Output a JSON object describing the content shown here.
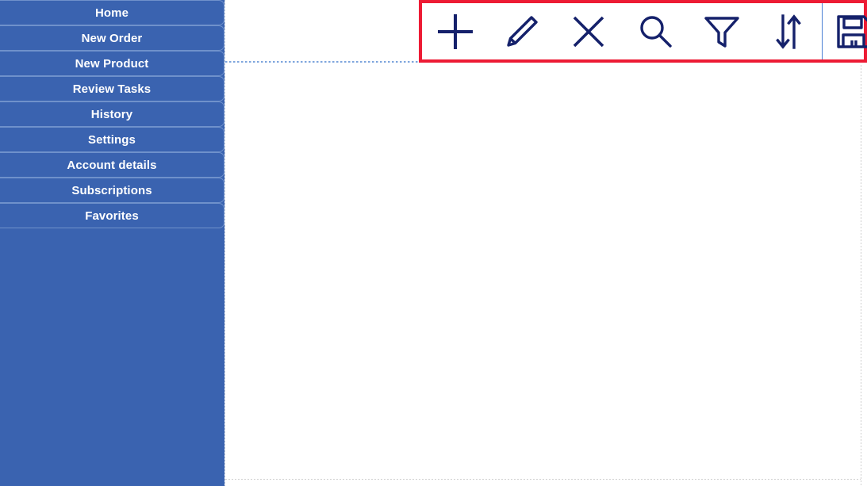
{
  "theme": {
    "sidebar_bg": "#3a63b0",
    "sidebar_item_border": "#6f91cb",
    "sidebar_text": "#ffffff",
    "icon_navy": "#15216b",
    "highlight_red": "#ed1b34",
    "divider_blue": "#4a7fd4",
    "content_bg": "#ffffff",
    "dotted_guide": "#7ea5dd"
  },
  "sidebar": {
    "items": [
      {
        "id": "home",
        "label": "Home"
      },
      {
        "id": "new-order",
        "label": "New Order"
      },
      {
        "id": "new-product",
        "label": "New Product"
      },
      {
        "id": "review-tasks",
        "label": "Review Tasks"
      },
      {
        "id": "history",
        "label": "History"
      },
      {
        "id": "settings",
        "label": "Settings"
      },
      {
        "id": "account-details",
        "label": "Account details"
      },
      {
        "id": "subscriptions",
        "label": "Subscriptions"
      },
      {
        "id": "favorites",
        "label": "Favorites"
      }
    ]
  },
  "toolbar": {
    "actions": [
      {
        "id": "add",
        "icon": "plus-icon",
        "label": "Add"
      },
      {
        "id": "edit",
        "icon": "pencil-icon",
        "label": "Edit"
      },
      {
        "id": "delete",
        "icon": "close-x-icon",
        "label": "Delete"
      },
      {
        "id": "search",
        "icon": "search-icon",
        "label": "Search"
      },
      {
        "id": "filter",
        "icon": "filter-funnel-icon",
        "label": "Filter"
      },
      {
        "id": "sort",
        "icon": "sort-arrows-icon",
        "label": "Sort"
      }
    ],
    "save": {
      "id": "save",
      "icon": "save-floppy-icon",
      "label": "Save"
    }
  },
  "main": {
    "content_text": ""
  }
}
